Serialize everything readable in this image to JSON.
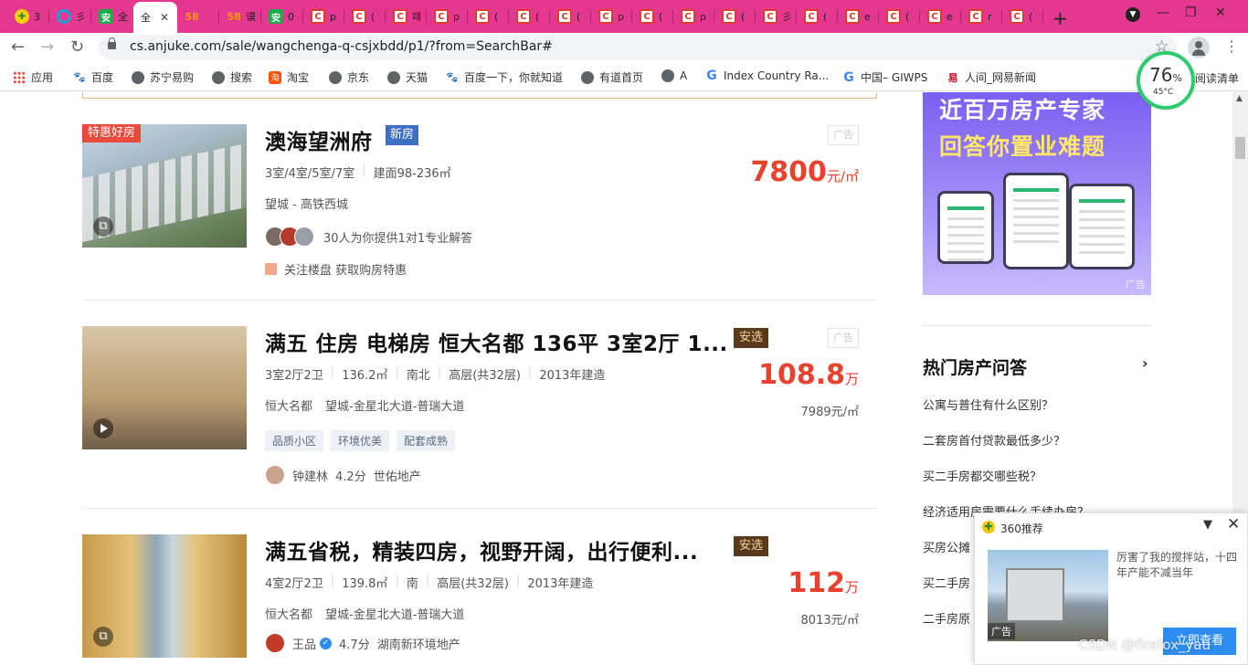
{
  "browser": {
    "tabs": [
      {
        "label": "3",
        "icon": "360-icon"
      },
      {
        "label": "彡",
        "icon": "ring-icon"
      },
      {
        "label": "全",
        "icon": "anjuke-icon"
      },
      {
        "label": "全",
        "icon": "anjuke-icon",
        "active": true
      },
      {
        "label": "",
        "icon": "58-icon"
      },
      {
        "label": "谟",
        "icon": "58-icon"
      },
      {
        "label": "0",
        "icon": "anjuke-icon"
      },
      {
        "label": "p",
        "icon": "c-icon"
      },
      {
        "label": "(",
        "icon": "c-icon"
      },
      {
        "label": "퍠",
        "icon": "c-icon"
      },
      {
        "label": "p",
        "icon": "c-icon"
      },
      {
        "label": "(",
        "icon": "c-icon"
      },
      {
        "label": "(",
        "icon": "c-icon"
      },
      {
        "label": "(",
        "icon": "c-icon"
      },
      {
        "label": "p",
        "icon": "c-icon"
      },
      {
        "label": "(",
        "icon": "c-icon"
      },
      {
        "label": "p",
        "icon": "c-icon"
      },
      {
        "label": "(",
        "icon": "c-icon"
      },
      {
        "label": "彡",
        "icon": "c-icon"
      },
      {
        "label": "(",
        "icon": "c-icon"
      },
      {
        "label": "e",
        "icon": "c-icon"
      },
      {
        "label": "(",
        "icon": "c-icon"
      },
      {
        "label": "e",
        "icon": "c-icon"
      },
      {
        "label": "r",
        "icon": "c-icon"
      },
      {
        "label": "(",
        "icon": "c-icon"
      }
    ],
    "url": "cs.anjuke.com/sale/wangchenga-q-csjxbdd/p1/?from=SearchBar#",
    "tab_color": "#e4378f"
  },
  "bookmarks": [
    {
      "label": "应用",
      "icon": "apps-grid-icon"
    },
    {
      "label": "百度",
      "icon": "baidu-paw-icon"
    },
    {
      "label": "苏宁易购",
      "icon": "globe-icon"
    },
    {
      "label": "搜索",
      "icon": "globe-icon"
    },
    {
      "label": "淘宝",
      "icon": "taobao-icon"
    },
    {
      "label": "京东",
      "icon": "globe-icon"
    },
    {
      "label": "天猫",
      "icon": "globe-icon"
    },
    {
      "label": "百度一下，你就知道",
      "icon": "baidu-paw-icon"
    },
    {
      "label": "有道首页",
      "icon": "globe-icon"
    },
    {
      "label": "A",
      "icon": "globe-icon"
    },
    {
      "label": "Index Country Ra...",
      "icon": "google-icon"
    },
    {
      "label": "中国– GIWPS",
      "icon": "google-icon"
    },
    {
      "label": "人间_网易新闻",
      "icon": "netease-icon"
    }
  ],
  "reading_list": "阅读清单",
  "weather": {
    "percent": "76",
    "percent_sign": "%",
    "temp": "45°C"
  },
  "listings": [
    {
      "badge": "特惠好房",
      "title": "澳海望洲府",
      "tag": "新房",
      "ad": "广告",
      "specs": [
        "3室/4室/5室/7室",
        "建面98-236㎡"
      ],
      "location": "望城 - 高铁西城",
      "agent_text": "30人为你提供1对1专业解答",
      "follow_text": "关注楼盘 获取购房特惠",
      "price": "7800",
      "price_unit": "元/㎡"
    },
    {
      "title": "满五 住房 电梯房 恒大名都 136平 3室2厅 1...",
      "tag": "安选",
      "ad": "广告",
      "specs": [
        "3室2厅2卫",
        "136.2㎡",
        "南北",
        "高层(共32层)",
        "2013年建造"
      ],
      "community": "恒大名都",
      "address": "望城-金星北大道-普瑞大道",
      "features": [
        "品质小区",
        "环境优美",
        "配套成熟"
      ],
      "agent": "钟建林",
      "score": "4.2分",
      "company": "世佑地产",
      "price": "108.8",
      "price_unit": "万",
      "unit_price": "7989元/㎡"
    },
    {
      "title": "满五省税，精装四房，视野开阔，出行便利...",
      "tag": "安选",
      "specs": [
        "4室2厅2卫",
        "139.8㎡",
        "南",
        "高层(共32层)",
        "2013年建造"
      ],
      "community": "恒大名都",
      "address": "望城-金星北大道-普瑞大道",
      "agent": "王品",
      "score": "4.7分",
      "company": "湖南新环境地产",
      "price": "112",
      "price_unit": "万",
      "unit_price": "8013元/㎡"
    }
  ],
  "side_ad": {
    "line1": "近百万房产专家",
    "line2": "回答你置业难题",
    "label": "广告"
  },
  "qa": {
    "title": "热门房产问答",
    "items": [
      "公寓与普住有什么区别？",
      "二套房首付贷款最低多少？",
      "买二手房都交哪些税？",
      "经济适用房需要什么手续办房？",
      "买房公摊",
      "买二手房",
      "二手房原"
    ]
  },
  "popup": {
    "title": "360推荐",
    "text": "厉害了我的搅拌站，十四年产能不减当年",
    "ad_label": "广告",
    "button": "立即查看"
  },
  "watermark": "CSDN @firefox_yau"
}
